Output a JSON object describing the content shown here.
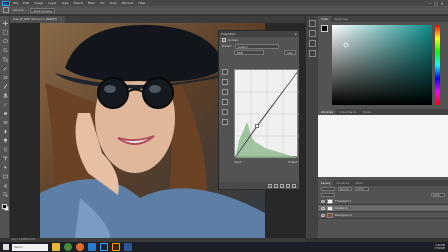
{
  "app": {
    "logo": "Ps",
    "menu": [
      "File",
      "Edit",
      "Image",
      "Layer",
      "Type",
      "Select",
      "Filter",
      "3D",
      "View",
      "Window",
      "Help"
    ]
  },
  "options": {
    "mode_label": "Normal",
    "opacity_label": "Opacity:",
    "opacity_value": "100%",
    "sample_label": "Sample:",
    "sample_value": "Point Sample"
  },
  "document": {
    "tab_title": "Lisa_W_OPE (Curves 1, RGB/8*)",
    "status_text": "Doc: 5.93M/6.02M"
  },
  "properties": {
    "title": "Properties",
    "adjustment_name": "Curves",
    "preset_label": "Preset:",
    "preset_value": "Custom",
    "channel_value": "RGB",
    "auto_label": "Auto",
    "input_label": "Input:",
    "output_label": "Output:"
  },
  "right": {
    "color_tabs": [
      "Color",
      "Swatches"
    ],
    "library_tabs": [
      "Libraries",
      "Adjustments",
      "Styles"
    ],
    "layers_tabs": [
      "Layers",
      "Channels",
      "Paths"
    ],
    "blend_value": "Normal",
    "opacity_value": "100%",
    "fill_value": "100%",
    "layers": [
      {
        "name": "Threshold 1",
        "selected": false
      },
      {
        "name": "Curves 1",
        "selected": true
      },
      {
        "name": "Background",
        "selected": false
      }
    ]
  },
  "taskbar": {
    "search_placeholder": "Search",
    "time": "5:30 PM",
    "date": "7/7/2020"
  },
  "colors": {
    "accent": "#31a8ff",
    "panel": "#535353",
    "menubar": "#484848"
  }
}
